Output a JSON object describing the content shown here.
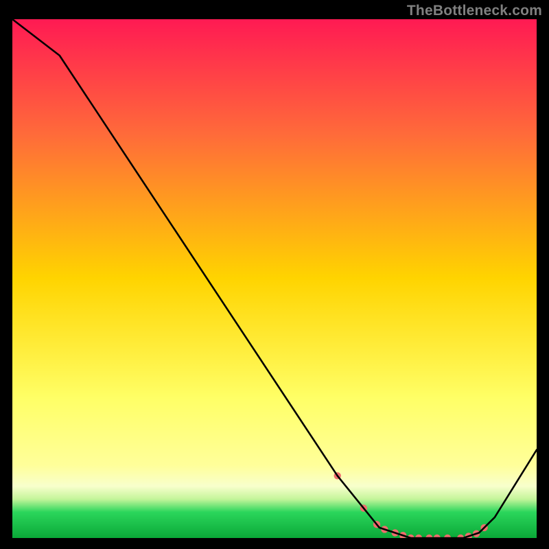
{
  "watermark": "TheBottleneck.com",
  "colors": {
    "grad_top": "#ff1a53",
    "grad_upper": "#ff6a3a",
    "grad_mid": "#ffd400",
    "grad_lower_yellow": "#ffff66",
    "grad_pale": "#f8ffcc",
    "grad_green": "#2bd65b",
    "grad_bottom": "#0aa838",
    "curve": "#000000",
    "dot": "#ef6d6d",
    "frame": "#000000"
  },
  "chart_data": {
    "type": "line",
    "title": "",
    "xlabel": "",
    "ylabel": "",
    "xlim": [
      0,
      100
    ],
    "ylim": [
      0,
      100
    ],
    "series": [
      {
        "name": "curve",
        "x": [
          0,
          9,
          62,
          70,
          76,
          82,
          86,
          89,
          92,
          100
        ],
        "y": [
          100,
          93,
          12,
          2,
          0,
          0,
          0,
          1,
          4,
          17
        ]
      }
    ],
    "dot_points_x": [
      62,
      67,
      69.5,
      71,
      73,
      74.5,
      76,
      77.5,
      79.5,
      81,
      83,
      85.5,
      87,
      88.5,
      90
    ],
    "gradient_stops_pct": [
      0,
      22,
      50,
      73,
      86,
      90,
      92.5,
      95,
      100
    ]
  }
}
